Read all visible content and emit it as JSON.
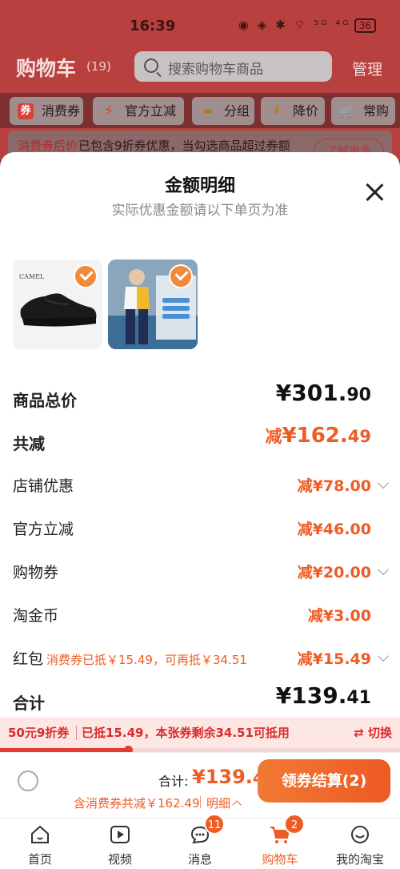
{
  "status": {
    "time": "16:39",
    "icons": "◉ ◈ ✱ ⌔ ⁵ᴳ ⁴ᴳ",
    "battery": "36"
  },
  "header": {
    "title": "购物车",
    "count": "(19)",
    "search_placeholder": "搜索购物车商品",
    "manage": "管理"
  },
  "chips": [
    {
      "label": "消费券",
      "icon": "券",
      "color": "#d8403a"
    },
    {
      "label": "官方立减",
      "icon": "⚡",
      "color": "#d8403a"
    },
    {
      "label": "分组",
      "icon": "▬",
      "color": "#b07a20"
    },
    {
      "label": "降价",
      "icon": "⬇",
      "color": "#c27a20"
    },
    {
      "label": "常购",
      "icon": "🛒",
      "color": "#b07a20"
    }
  ],
  "coupon_note": {
    "red": "消费券后价",
    "rest": "已包含9折券优惠，当勾选商品超过券额",
    "button": "了解更多"
  },
  "sheet": {
    "title": "金额明细",
    "subtitle": "实际优惠金额请以下单页为准",
    "rows": {
      "goods_total": {
        "label": "商品总价",
        "main": "¥301.",
        "dec": "90"
      },
      "total_discount": {
        "label": "共减",
        "jian": "减",
        "main": "¥162.",
        "dec": "49"
      },
      "shop": {
        "label": "店铺优惠",
        "value": "减¥78.00"
      },
      "official": {
        "label": "官方立减",
        "value": "减¥46.00"
      },
      "coupon": {
        "label": "购物券",
        "value": "减¥20.00"
      },
      "coins": {
        "label": "淘金币",
        "value": "减¥3.00"
      },
      "redpacket": {
        "label": "红包",
        "note": "消费券已抵￥15.49，可再抵￥34.51",
        "value": "减¥15.49"
      },
      "sum": {
        "label": "合计",
        "main": "¥139.",
        "dec": "41"
      }
    }
  },
  "info_strip": {
    "t1": "50元9折券",
    "t2": "已抵15.49，本张券剩余34.51可抵用",
    "switch": "⇄ 切换"
  },
  "checkout": {
    "total_label": "合计:",
    "total_main": "¥139.",
    "total_dec": "41",
    "discount_line": "含消费券共减￥162.49",
    "detail": "明细",
    "button": "领券结算(2)"
  },
  "tabs": [
    {
      "label": "首页"
    },
    {
      "label": "视频"
    },
    {
      "label": "消息",
      "badge": "11"
    },
    {
      "label": "购物车",
      "badge": "2"
    },
    {
      "label": "我的淘宝"
    }
  ],
  "colors": {
    "accent": "#ef5b24",
    "red": "#d92c2c"
  }
}
